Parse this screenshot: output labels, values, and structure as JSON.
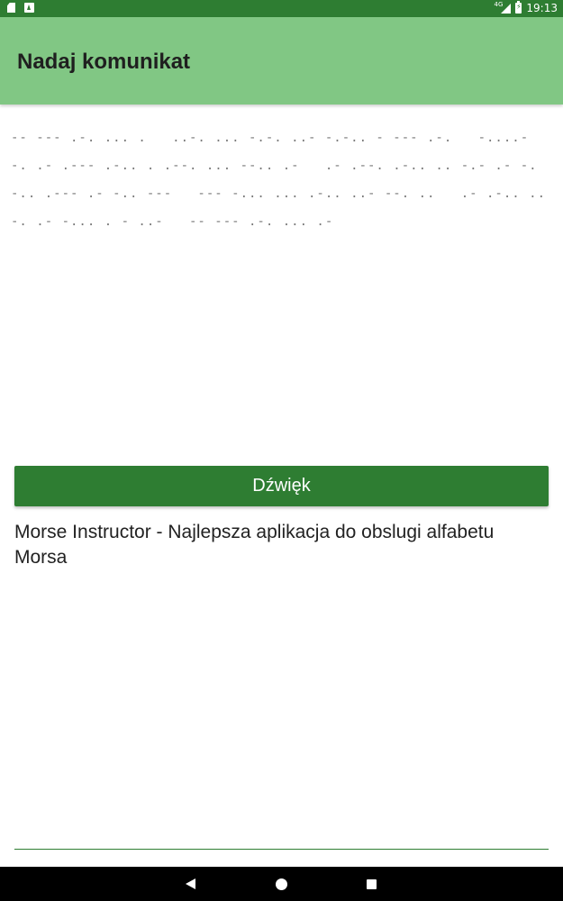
{
  "status_bar": {
    "network": "4G",
    "time": "19:13",
    "icons": [
      "sd-card-icon",
      "app-a-icon",
      "signal-icon",
      "battery-charging-icon"
    ]
  },
  "app_bar": {
    "title": "Nadaj komunikat"
  },
  "morse": {
    "text": "-- --- .-. ... .   ..-. ... -.-. ..- -.-.. - --- .-.   -....- -. .- .--- .-.. . .--. ... --.. .-   .- .--. .-.. .. -.- .- -.-.. .--- .- -.. ---   --- -... ... .-.. ..- --. ..   .- .-.. ..-. .- -... . - ..-   -- --- .-. ... .-"
  },
  "sound_button": {
    "label": "Dźwięk"
  },
  "ad": {
    "text": "Morse Instructor - Najlepsza aplikacja do obslugi alfabetu Morsa"
  },
  "nav_bar": {
    "icons": [
      "back-icon",
      "home-icon",
      "recents-icon"
    ]
  },
  "colors": {
    "status_bar": "#2e7d32",
    "app_bar": "#81c784",
    "button": "#2e7d32",
    "morse_text": "#7a7a7a"
  }
}
